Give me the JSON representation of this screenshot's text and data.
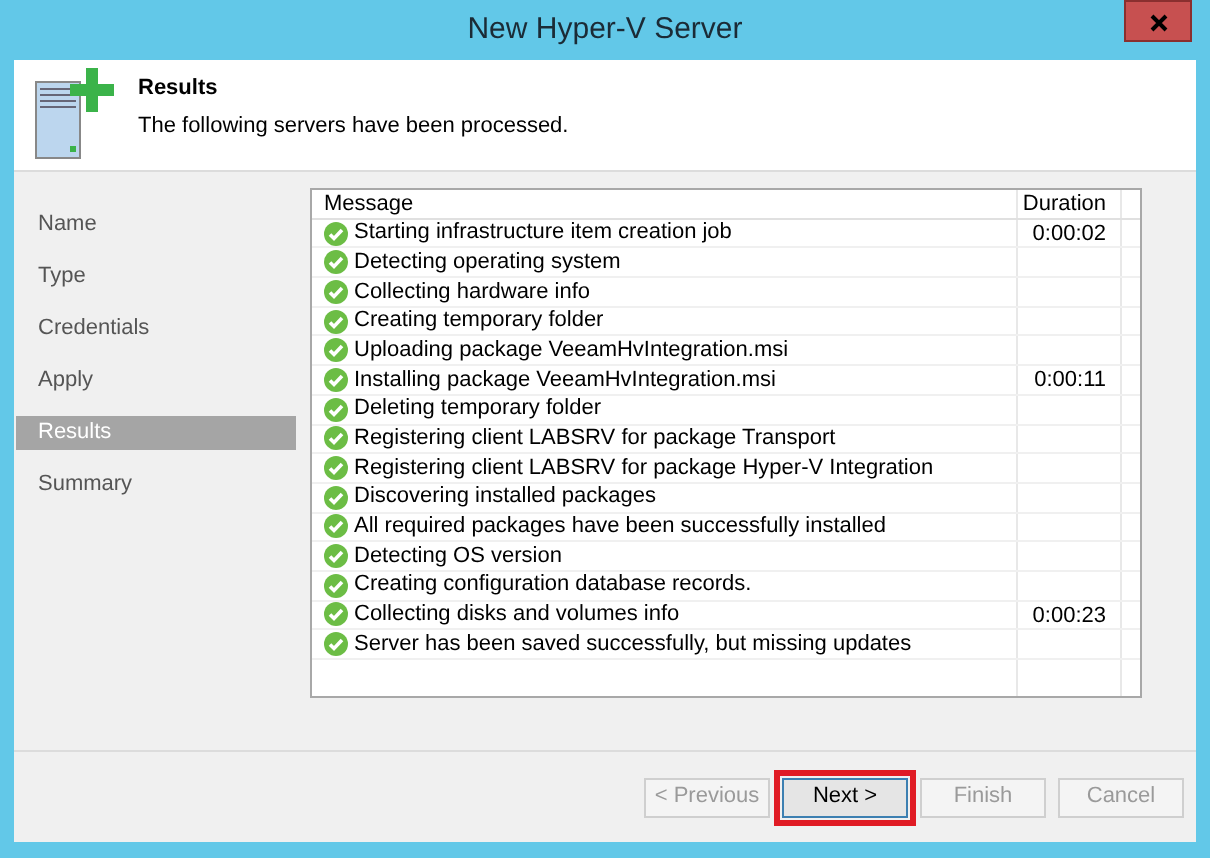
{
  "window": {
    "title": "New Hyper-V Server"
  },
  "header": {
    "title": "Results",
    "subtitle": "The following servers have been processed."
  },
  "steps": [
    {
      "label": "Name",
      "selected": false
    },
    {
      "label": "Type",
      "selected": false
    },
    {
      "label": "Credentials",
      "selected": false
    },
    {
      "label": "Apply",
      "selected": false
    },
    {
      "label": "Results",
      "selected": true
    },
    {
      "label": "Summary",
      "selected": false
    }
  ],
  "table": {
    "columns": [
      "Message",
      "Duration"
    ],
    "rows": [
      {
        "ok": true,
        "message": "Starting infrastructure item creation job",
        "duration": "0:00:02"
      },
      {
        "ok": true,
        "message": "Detecting operating system"
      },
      {
        "ok": true,
        "message": "Collecting hardware info"
      },
      {
        "ok": true,
        "message": "Creating temporary folder"
      },
      {
        "ok": true,
        "message": "Uploading package VeeamHvIntegration.msi"
      },
      {
        "ok": true,
        "message": "Installing package VeeamHvIntegration.msi",
        "duration": "0:00:11"
      },
      {
        "ok": true,
        "message": "Deleting temporary folder"
      },
      {
        "ok": true,
        "message": "Registering client LABSRV for package Transport"
      },
      {
        "ok": true,
        "message": "Registering client LABSRV for package Hyper-V Integration"
      },
      {
        "ok": true,
        "message": "Discovering installed packages"
      },
      {
        "ok": true,
        "message": "All required packages have been successfully installed"
      },
      {
        "ok": true,
        "message": "Detecting OS version"
      },
      {
        "ok": true,
        "message": "Creating configuration database records."
      },
      {
        "ok": true,
        "message": "Collecting disks and volumes info",
        "duration": "0:00:23"
      },
      {
        "ok": true,
        "message": "Server has been saved successfully, but missing updates"
      }
    ]
  },
  "buttons": [
    {
      "label": "< Previous",
      "disabled": true,
      "highlighted": false
    },
    {
      "label": "Next >",
      "disabled": false,
      "highlighted": true
    },
    {
      "label": "Finish",
      "disabled": true,
      "highlighted": false
    },
    {
      "label": "Cancel",
      "disabled": true,
      "highlighted": false
    }
  ]
}
